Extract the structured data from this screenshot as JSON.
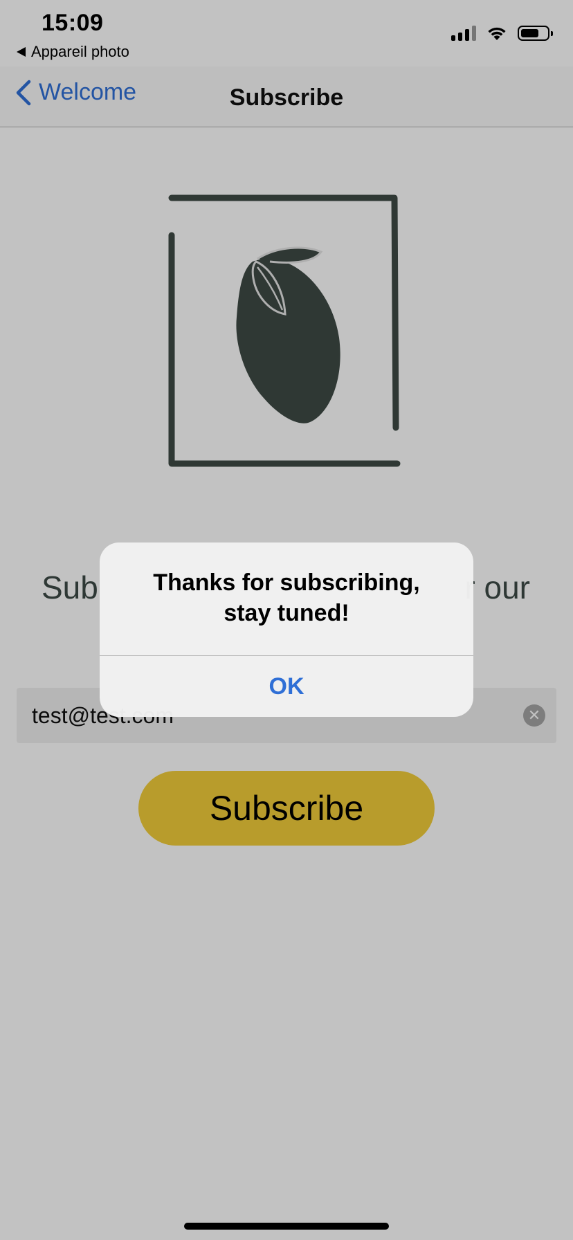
{
  "status_bar": {
    "time": "15:09",
    "back_app": "Appareil photo",
    "signal_icon": "cellular-signal-icon",
    "wifi_icon": "wifi-icon",
    "battery_icon": "battery-icon",
    "battery_level": 0.7
  },
  "nav": {
    "back_label": "Welcome",
    "back_icon": "chevron-left-icon",
    "title": "Subscribe"
  },
  "logo": {
    "icon": "lemon-in-frame-icon",
    "color": "#3e4a45"
  },
  "content": {
    "subtitle_left": "Sub",
    "subtitle_right": "r our",
    "email_value": "test@test.com",
    "clear_icon": "clear-icon",
    "subscribe_label": "Subscribe",
    "subscribe_color": "#f2ce3a"
  },
  "alert": {
    "message_line1": "Thanks for subscribing,",
    "message_line2": "stay tuned!",
    "ok_label": "OK",
    "accent": "#2f6fd6"
  }
}
